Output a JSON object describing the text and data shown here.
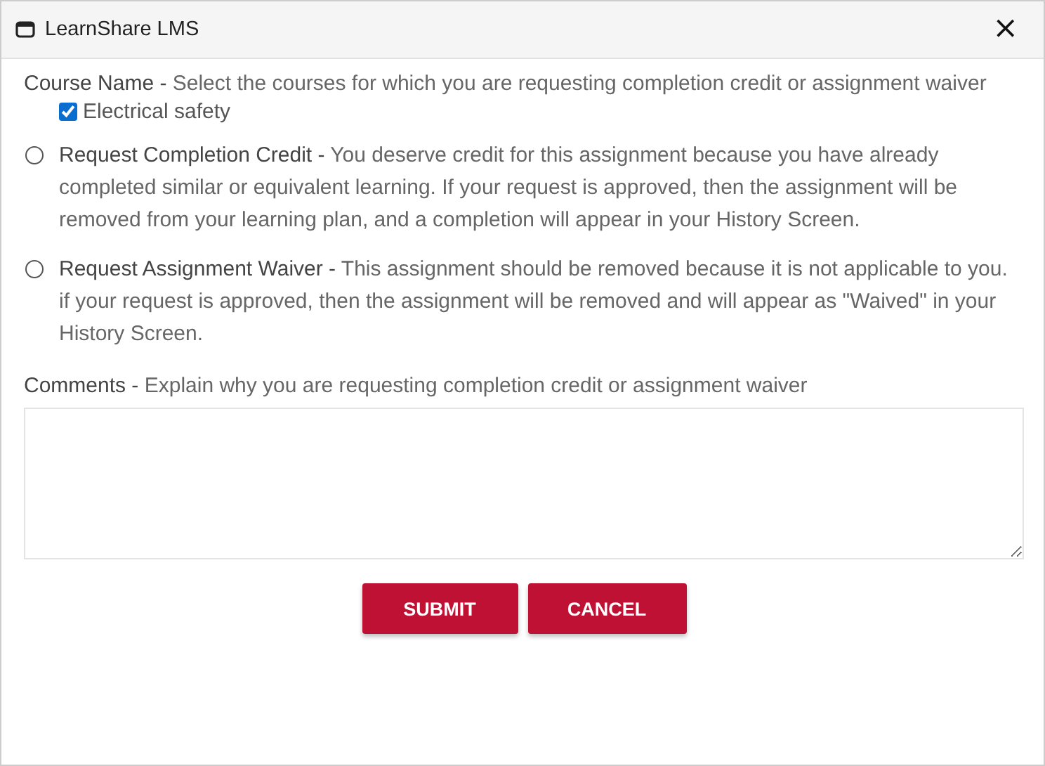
{
  "window": {
    "title": "LearnShare LMS",
    "close": "×"
  },
  "course": {
    "label": "Course Name -",
    "text": "Select the courses for which you are requesting completion credit or assignment waiver",
    "items": [
      {
        "label": "Electrical safety",
        "checked": true
      }
    ]
  },
  "options": [
    {
      "label": "Request Completion Credit -",
      "text": "You deserve credit for this assignment because you have already completed similar or equivalent learning. If your request is approved, then the assignment will be removed from your learning plan, and a completion will appear in your History Screen.",
      "selected": false
    },
    {
      "label": "Request Assignment Waiver -",
      "text": "This assignment should be removed because it is not applicable to you. if your request is approved, then the assignment will be removed and will appear as \"Waived\" in your History Screen.",
      "selected": false
    }
  ],
  "comments": {
    "label": "Comments -",
    "text": "Explain why you are requesting completion credit or assignment waiver"
  },
  "buttons": [
    "SUBMIT",
    "CANCEL"
  ]
}
